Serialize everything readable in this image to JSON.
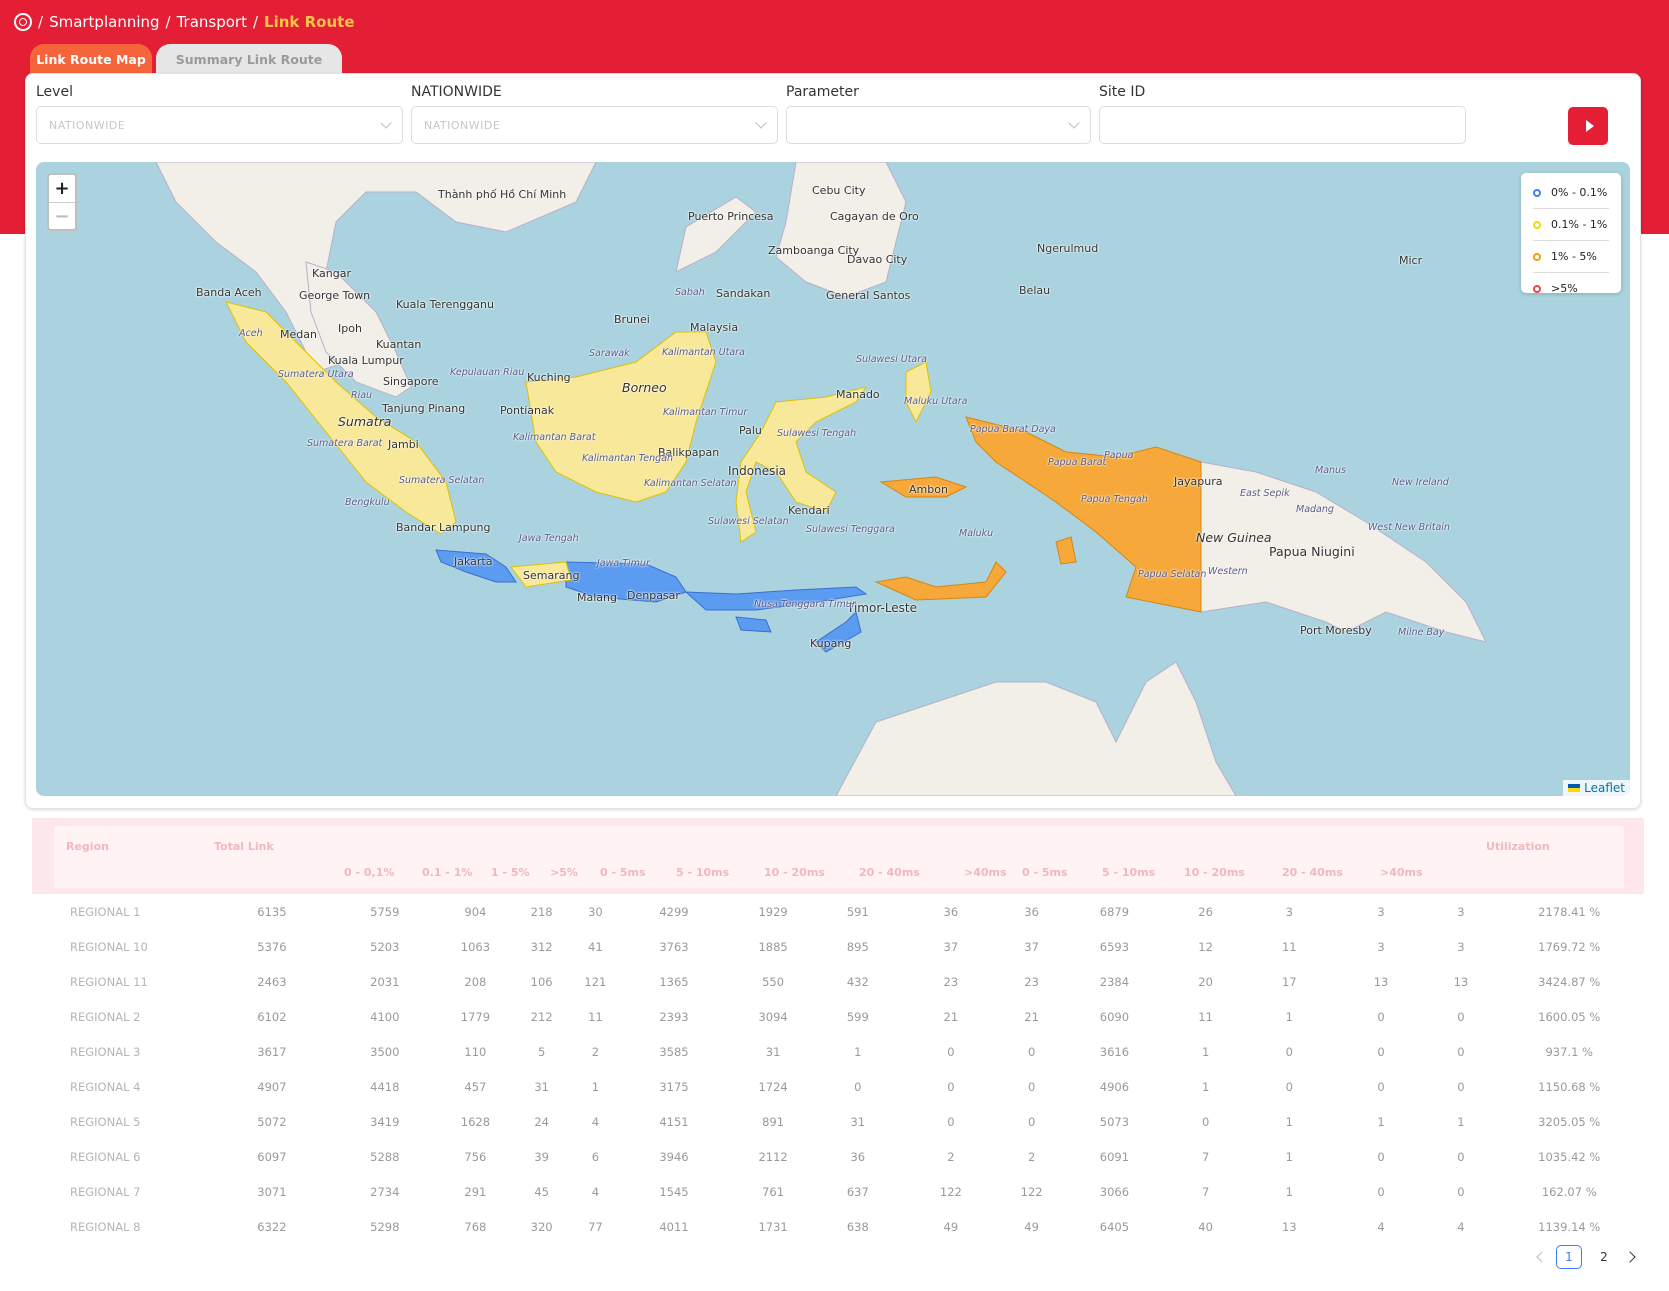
{
  "breadcrumb": {
    "items": [
      "Smartplanning",
      "Transport"
    ],
    "current": "Link Route",
    "separator": "/"
  },
  "tabs": [
    {
      "label": "Link Route Map",
      "active": true
    },
    {
      "label": "Summary Link Route",
      "active": false
    }
  ],
  "filters": {
    "level": {
      "label": "Level",
      "value": "NATIONWIDE"
    },
    "nationwide": {
      "label": "NATIONWIDE",
      "value": "NATIONWIDE"
    },
    "parameter": {
      "label": "Parameter",
      "value": ""
    },
    "site_id": {
      "label": "Site ID",
      "value": ""
    }
  },
  "map": {
    "zoom_in": "+",
    "zoom_out": "−",
    "attribution": "Leaflet",
    "legend": [
      {
        "label": "0% - 0.1%",
        "color": "#3b82f6"
      },
      {
        "label": "0.1% - 1%",
        "color": "#f5d60a"
      },
      {
        "label": "1% - 5%",
        "color": "#f59e0b"
      },
      {
        "label": ">5%",
        "color": "#ef4444"
      }
    ],
    "labels": [
      "Thành phố Hồ Chí Minh",
      "Puerto Princesa",
      "Cebu City",
      "Cagayan de Oro",
      "Zamboanga City",
      "Davao City",
      "General Santos",
      "Ngerulmud",
      "Belau",
      "Kangar",
      "George Town",
      "Kuala Terengganu",
      "Banda Aceh",
      "Ipoh",
      "Medan",
      "Kuantan",
      "Kuala Lumpur",
      "Singapore",
      "Tanjung Pinang",
      "Sumatra",
      "Jambi",
      "Bandar Lampung",
      "Kuching",
      "Pontianak",
      "Borneo",
      "Brunei",
      "Sandakan",
      "Malaysia",
      "Balikpapan",
      "Palu",
      "Manado",
      "Indonesia",
      "Kendari",
      "Ambon",
      "Jayapura",
      "New Guinea",
      "Papua Niugini",
      "Port Moresby",
      "Jakarta",
      "Semarang",
      "Malang",
      "Denpasar",
      "Timor-Leste",
      "Kupang",
      "Micr"
    ],
    "region_labels": [
      "Aceh",
      "Sumatera Utara",
      "Riau",
      "Sumatera Barat",
      "Sumatera Selatan",
      "Bengkulu",
      "Kepulauan Riau",
      "Sarawak",
      "Sabah",
      "Kalimantan Utara",
      "Kalimantan Timur",
      "Kalimantan Barat",
      "Kalimantan Tengah",
      "Kalimantan Selatan",
      "Sulawesi Utara",
      "Sulawesi Tengah",
      "Sulawesi Selatan",
      "Sulawesi Tenggara",
      "Maluku Utara",
      "Maluku",
      "Papua Barat Daya",
      "Papua Barat",
      "Papua",
      "Papua Tengah",
      "Papua Selatan",
      "Jawa Tengah",
      "Jawa Timur",
      "Nusa Tenggara Timur",
      "East Sepik",
      "Madang",
      "Manus",
      "New Ireland",
      "West New Britain",
      "Western",
      "Milne Bay"
    ]
  },
  "table": {
    "headers": [
      "Region",
      "Total Link",
      "0 - 0,1%",
      "0.1 - 1%",
      "1 - 5%",
      ">5%",
      "0 - 5ms",
      "5 - 10ms",
      "10 - 20ms",
      "20 - 40ms",
      ">40ms",
      "0 - 5ms",
      "5 - 10ms",
      "10 - 20ms",
      "20 - 40ms",
      ">40ms",
      "Utilization"
    ],
    "rows": [
      [
        "REGIONAL 1",
        "6135",
        "5759",
        "904",
        "218",
        "30",
        "4299",
        "1929",
        "591",
        "36",
        "36",
        "6879",
        "26",
        "3",
        "3",
        "3",
        "2178.41 %"
      ],
      [
        "REGIONAL 10",
        "5376",
        "5203",
        "1063",
        "312",
        "41",
        "3763",
        "1885",
        "895",
        "37",
        "37",
        "6593",
        "12",
        "11",
        "3",
        "3",
        "1769.72 %"
      ],
      [
        "REGIONAL 11",
        "2463",
        "2031",
        "208",
        "106",
        "121",
        "1365",
        "550",
        "432",
        "23",
        "23",
        "2384",
        "20",
        "17",
        "13",
        "13",
        "3424.87 %"
      ],
      [
        "REGIONAL 2",
        "6102",
        "4100",
        "1779",
        "212",
        "11",
        "2393",
        "3094",
        "599",
        "21",
        "21",
        "6090",
        "11",
        "1",
        "0",
        "0",
        "1600.05 %"
      ],
      [
        "REGIONAL 3",
        "3617",
        "3500",
        "110",
        "5",
        "2",
        "3585",
        "31",
        "1",
        "0",
        "0",
        "3616",
        "1",
        "0",
        "0",
        "0",
        "937.1 %"
      ],
      [
        "REGIONAL 4",
        "4907",
        "4418",
        "457",
        "31",
        "1",
        "3175",
        "1724",
        "0",
        "0",
        "0",
        "4906",
        "1",
        "0",
        "0",
        "0",
        "1150.68 %"
      ],
      [
        "REGIONAL 5",
        "5072",
        "3419",
        "1628",
        "24",
        "4",
        "4151",
        "891",
        "31",
        "0",
        "0",
        "5073",
        "0",
        "1",
        "1",
        "1",
        "3205.05 %"
      ],
      [
        "REGIONAL 6",
        "6097",
        "5288",
        "756",
        "39",
        "6",
        "3946",
        "2112",
        "36",
        "2",
        "2",
        "6091",
        "7",
        "1",
        "0",
        "0",
        "1035.42 %"
      ],
      [
        "REGIONAL 7",
        "3071",
        "2734",
        "291",
        "45",
        "4",
        "1545",
        "761",
        "637",
        "122",
        "122",
        "3066",
        "7",
        "1",
        "0",
        "0",
        "162.07 %"
      ],
      [
        "REGIONAL 8",
        "6322",
        "5298",
        "768",
        "320",
        "77",
        "4011",
        "1731",
        "638",
        "49",
        "49",
        "6405",
        "40",
        "13",
        "4",
        "4",
        "1139.14 %"
      ]
    ]
  },
  "pagination": {
    "pages": [
      "1",
      "2"
    ],
    "current": "1"
  }
}
